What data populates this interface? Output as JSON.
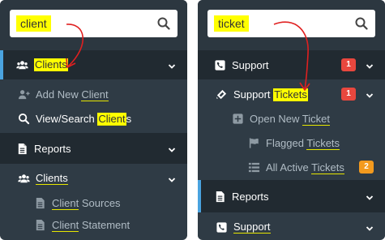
{
  "left_panel": {
    "search_value": "client",
    "items": [
      {
        "label": "Clients"
      },
      {
        "label": "Add New Client"
      },
      {
        "label": "View/Search Clients"
      },
      {
        "label": "Reports"
      },
      {
        "label": "Clients"
      },
      {
        "label": "Client Sources"
      },
      {
        "label": "Client Statement"
      }
    ]
  },
  "right_panel": {
    "search_value": "ticket",
    "items": [
      {
        "label": "Support",
        "badge": "1"
      },
      {
        "label": "Support Tickets",
        "badge": "1"
      },
      {
        "label": "Open New Ticket"
      },
      {
        "label": "Flagged Tickets"
      },
      {
        "label": "All Active Tickets",
        "badge": "2"
      },
      {
        "label": "Reports"
      },
      {
        "label": "Support"
      }
    ]
  },
  "colors": {
    "panel": "#2f3b45",
    "bar": "#212a31",
    "accent": "#4aa3df",
    "highlight": "#ffff00",
    "badge_red": "#e8473e",
    "badge_orange": "#f39a1e",
    "arrow": "#e02020"
  },
  "icons": [
    "search-icon",
    "users-icon",
    "user-plus-icon",
    "search-icon",
    "document-icon",
    "chevron-down-icon",
    "phone-icon",
    "ticket-icon",
    "plus-square-icon",
    "flag-icon",
    "list-icon"
  ]
}
